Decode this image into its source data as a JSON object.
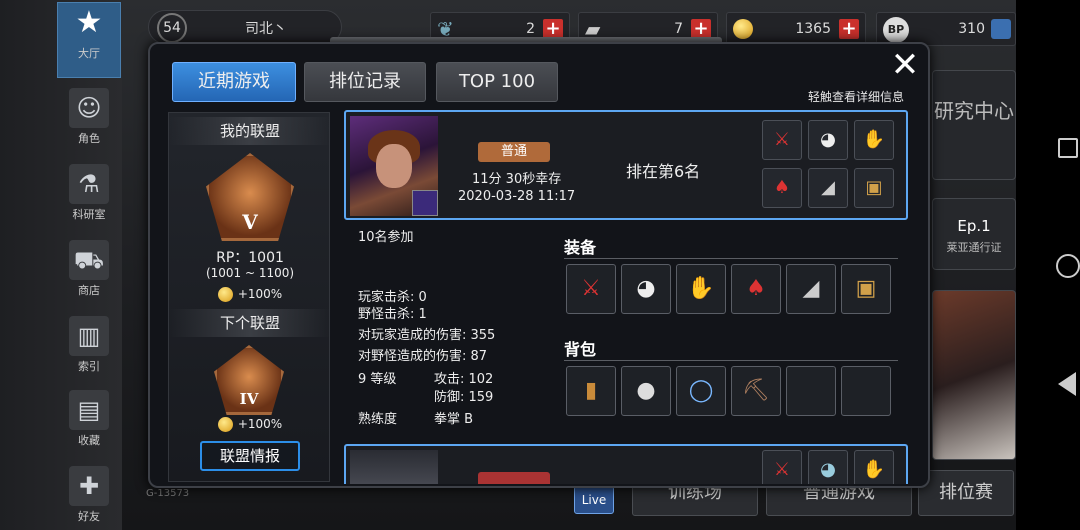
{
  "left_nav": [
    {
      "label": "大厅",
      "icon": "star-icon"
    },
    {
      "label": "角色",
      "icon": "character-icon"
    },
    {
      "label": "科研室",
      "icon": "flask-icon"
    },
    {
      "label": "商店",
      "icon": "cart-icon"
    },
    {
      "label": "索引",
      "icon": "books-icon"
    },
    {
      "label": "收藏",
      "icon": "book-icon"
    },
    {
      "label": "好友",
      "icon": "gamepad-icon"
    }
  ],
  "top_bar": {
    "level": "54",
    "player_name": "司北丶",
    "currency": [
      {
        "icon": "feather-icon",
        "value": "2"
      },
      {
        "icon": "box-icon",
        "value": "7"
      },
      {
        "icon": "coin-icon",
        "value": "1365"
      },
      {
        "icon": "bp-icon",
        "value": "310"
      }
    ]
  },
  "background": {
    "research_center": "研究中心",
    "ep_label": "Ep.1",
    "pass_label": "莱亚通行证",
    "live": "Live",
    "bottom_buttons": [
      "训练场",
      "普通游戏",
      "排位赛"
    ],
    "zone_label": "G-13573"
  },
  "dialog": {
    "tabs": [
      "近期游戏",
      "排位记录",
      "TOP 100"
    ],
    "active_tab": "近期游戏",
    "hint": "轻触查看详细信息",
    "league": {
      "my_title": "我的联盟",
      "my_tier": "V",
      "rp": "RP：1001",
      "rp_range": "(1001 ~ 1100)",
      "my_bonus": "+100%",
      "next_title": "下个联盟",
      "next_tier": "IV",
      "next_bonus": "+100%",
      "info_button": "联盟情报"
    },
    "match": {
      "mode": "普通",
      "survive": "11分 30秒幸存",
      "date": "2020-03-28 11:17",
      "rank": "排在第6名",
      "equip_icons": [
        "weapon-icon",
        "mask-icon",
        "gloves-icon",
        "armor-icon",
        "shoes-icon",
        "crate-icon"
      ]
    },
    "details": {
      "participants": "10名参加",
      "player_kills": "玩家击杀: 0",
      "monster_kills": "野怪击杀: 1",
      "damage_players": "对玩家造成的伤害: 355",
      "damage_monsters": "对野怪造成的伤害: 87",
      "level": "9 等级",
      "attack": "攻击: 102",
      "defense": "防御: 159",
      "mastery_label": "熟练度",
      "mastery_value": "拳掌 B",
      "equipment_title": "装备",
      "backpack_title": "背包",
      "backpack_icons": [
        "cup-icon",
        "pot-icon",
        "bracelet-icon",
        "pickaxe-icon",
        "",
        ""
      ]
    }
  },
  "colors": {
    "accent": "#2a7fd6",
    "border_active": "#5da7f2",
    "mode_badge": "#b06a3a",
    "plus": "#c9302c"
  }
}
